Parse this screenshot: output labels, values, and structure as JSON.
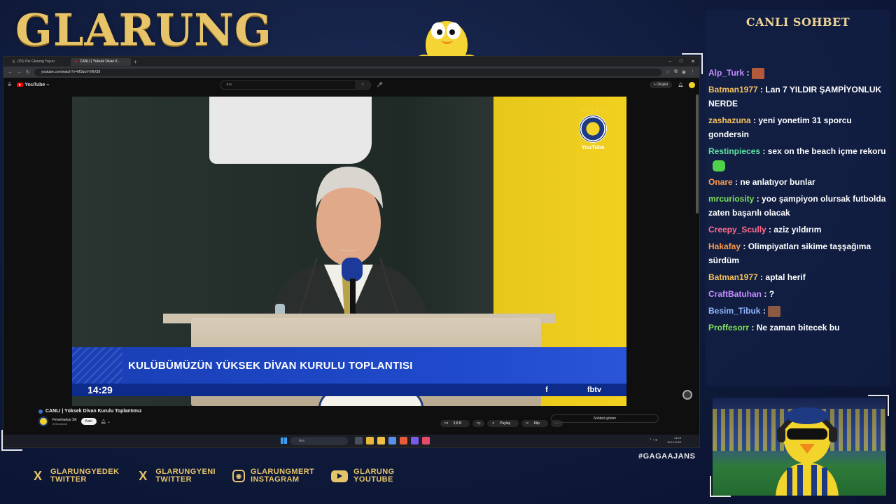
{
  "overlay": {
    "brand": "GLARUNG",
    "hashtag": "#GAGAAJANS",
    "accent_color": "#e5c46a",
    "socials": [
      {
        "icon": "x-icon",
        "line1": "GLARUNGYEDEK",
        "line2": "TWITTER"
      },
      {
        "icon": "x-icon",
        "line1": "GLARUNGYENI",
        "line2": "TWITTER"
      },
      {
        "icon": "instagram-icon",
        "line1": "GLARUNGMERT",
        "line2": "INSTAGRAM"
      },
      {
        "icon": "youtube-icon",
        "line1": "GLARUNG",
        "line2": "YOUTUBE"
      }
    ]
  },
  "browser": {
    "tabs": [
      {
        "label": "(29) X'te Glarung Yayını",
        "active": false
      },
      {
        "label": "CANLI | Yüksek Divan K...",
        "active": true
      }
    ],
    "url": "youtube.com/watch?v=MSbuV-6RX58"
  },
  "youtube": {
    "logo": "YouTube",
    "country": "TR",
    "search_placeholder": "Ara",
    "create_label": "Oluştur",
    "video": {
      "badge_text": "YouTube",
      "stars": "★★★★★",
      "headline": "KULÜBÜMÜZÜN YÜKSEK DİVAN KURULU TOPLANTISI",
      "clock": "14:29",
      "fb_icon": "f",
      "channel_tag": "fbtv"
    },
    "title": "CANLI | Yüksek Divan Kurulu Toplantımız",
    "channel": "Fenerbahçe SK",
    "subscribers": "3 Mn abone",
    "join_label": "Katıl",
    "likes": "3,8 B",
    "share_label": "Paylaş",
    "clip_label": "Klip",
    "chat_toggle": "Sohbeti göster"
  },
  "taskbar": {
    "search_placeholder": "Ara",
    "time": "14:29",
    "date": "16.10.2025"
  },
  "chat": {
    "header": "CANLI SOHBET",
    "messages": [
      {
        "nick": "Alp_Turk",
        "color": "#c68cff",
        "text": "",
        "emote": "#b35a3a"
      },
      {
        "nick": "Batman1977",
        "color": "#f3c15c",
        "text": "Lan 7 YILDIR ŞAMPİYONLUK NERDE"
      },
      {
        "nick": "zashazuna",
        "color": "#f3c15c",
        "text": "yeni yonetim 31 sporcu gondersin"
      },
      {
        "nick": "Restinpieces",
        "color": "#5ee0a0",
        "text": "sex on the beach içme rekoru",
        "emote_after": "#4fd14a"
      },
      {
        "nick": "Onare",
        "color": "#ff9b4a",
        "text": "ne anlatıyor bunlar"
      },
      {
        "nick": "mrcuriosity",
        "color": "#7ee05a",
        "text": "yoo şampiyon olursak futbolda zaten başarılı olacak"
      },
      {
        "nick": "Creepy_Scully",
        "color": "#ff6b8a",
        "text": "aziz yıldırım"
      },
      {
        "nick": "Hakafay",
        "color": "#ff9b4a",
        "text": "Olimpiyatları sikime taşşağıma sürdüm"
      },
      {
        "nick": "Batman1977",
        "color": "#f3c15c",
        "text": "aptal herif"
      },
      {
        "nick": "CraftBatuhan",
        "color": "#c68cff",
        "text": "?"
      },
      {
        "nick": "Besim_Tibuk",
        "color": "#8fb6ff",
        "text": "",
        "emote": "#8a5a42"
      },
      {
        "nick": "Proffesorr",
        "color": "#7ee05a",
        "text": "Ne zaman bitecek bu"
      }
    ]
  }
}
